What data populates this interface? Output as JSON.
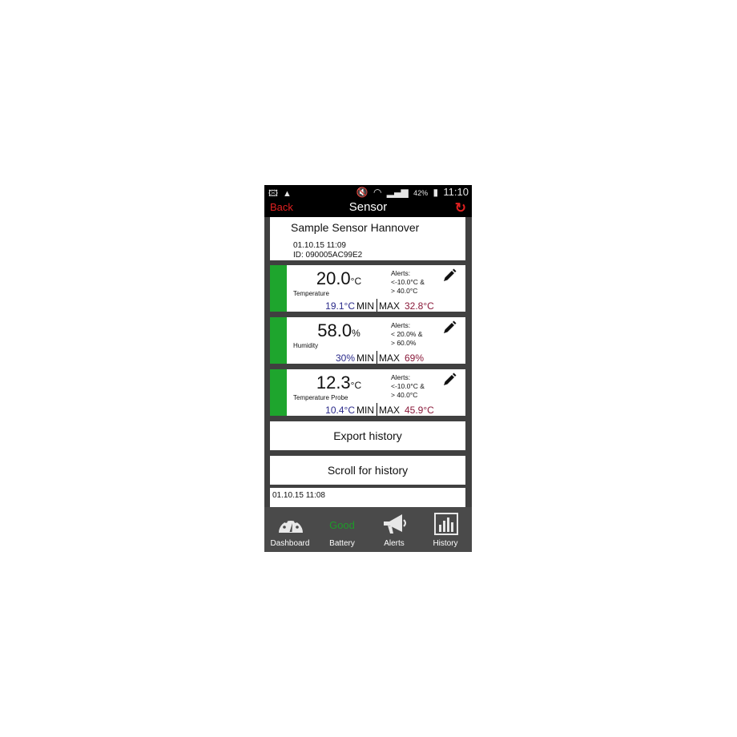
{
  "status_bar": {
    "left_icons": [
      "image-icon",
      "warning-icon"
    ],
    "right_icons": [
      "mute-icon",
      "wifi-icon",
      "signal-icon"
    ],
    "battery": "42%",
    "time": "11:10"
  },
  "header": {
    "back_label": "Back",
    "title": "Sensor",
    "refresh_icon": "refresh-icon"
  },
  "sensor": {
    "name": "Sample Sensor Hannover",
    "date": "01.10.15  11:09",
    "id": "ID: 090005AC99E2"
  },
  "readings": [
    {
      "value": "20.0",
      "unit": "°C",
      "label": "Temperature",
      "alerts": [
        "Alerts:",
        "<-10.0°C &",
        "> 40.0°C"
      ],
      "min": "19.1°C",
      "min_label": "MIN",
      "max_label": "MAX",
      "max": "32.8°C"
    },
    {
      "value": "58.0",
      "unit": "%",
      "label": "Humidity",
      "alerts": [
        "Alerts:",
        "< 20.0% &",
        "> 60.0%"
      ],
      "min": "30%",
      "min_label": "MIN",
      "max_label": "MAX",
      "max": "69%"
    },
    {
      "value": "12.3",
      "unit": "°C",
      "label": "Temperature Probe",
      "alerts": [
        "Alerts:",
        "<-10.0°C &",
        "> 40.0°C"
      ],
      "min": "10.4°C",
      "min_label": "MIN",
      "max_label": "MAX",
      "max": "45.9°C"
    }
  ],
  "actions": {
    "export": "Export history",
    "scroll": "Scroll for history"
  },
  "history": {
    "first_time": "01.10.15  11:08"
  },
  "tabs": [
    {
      "label": "Dashboard",
      "icon": "gauge-icon"
    },
    {
      "label": "Battery",
      "status": "Good"
    },
    {
      "label": "Alerts",
      "icon": "megaphone-icon"
    },
    {
      "label": "History",
      "icon": "bar-chart-icon"
    }
  ],
  "colors": {
    "status_ok": "#1ea52d",
    "accent": "#e02020",
    "min": "#2a2a8a",
    "max": "#8a1a3a"
  }
}
